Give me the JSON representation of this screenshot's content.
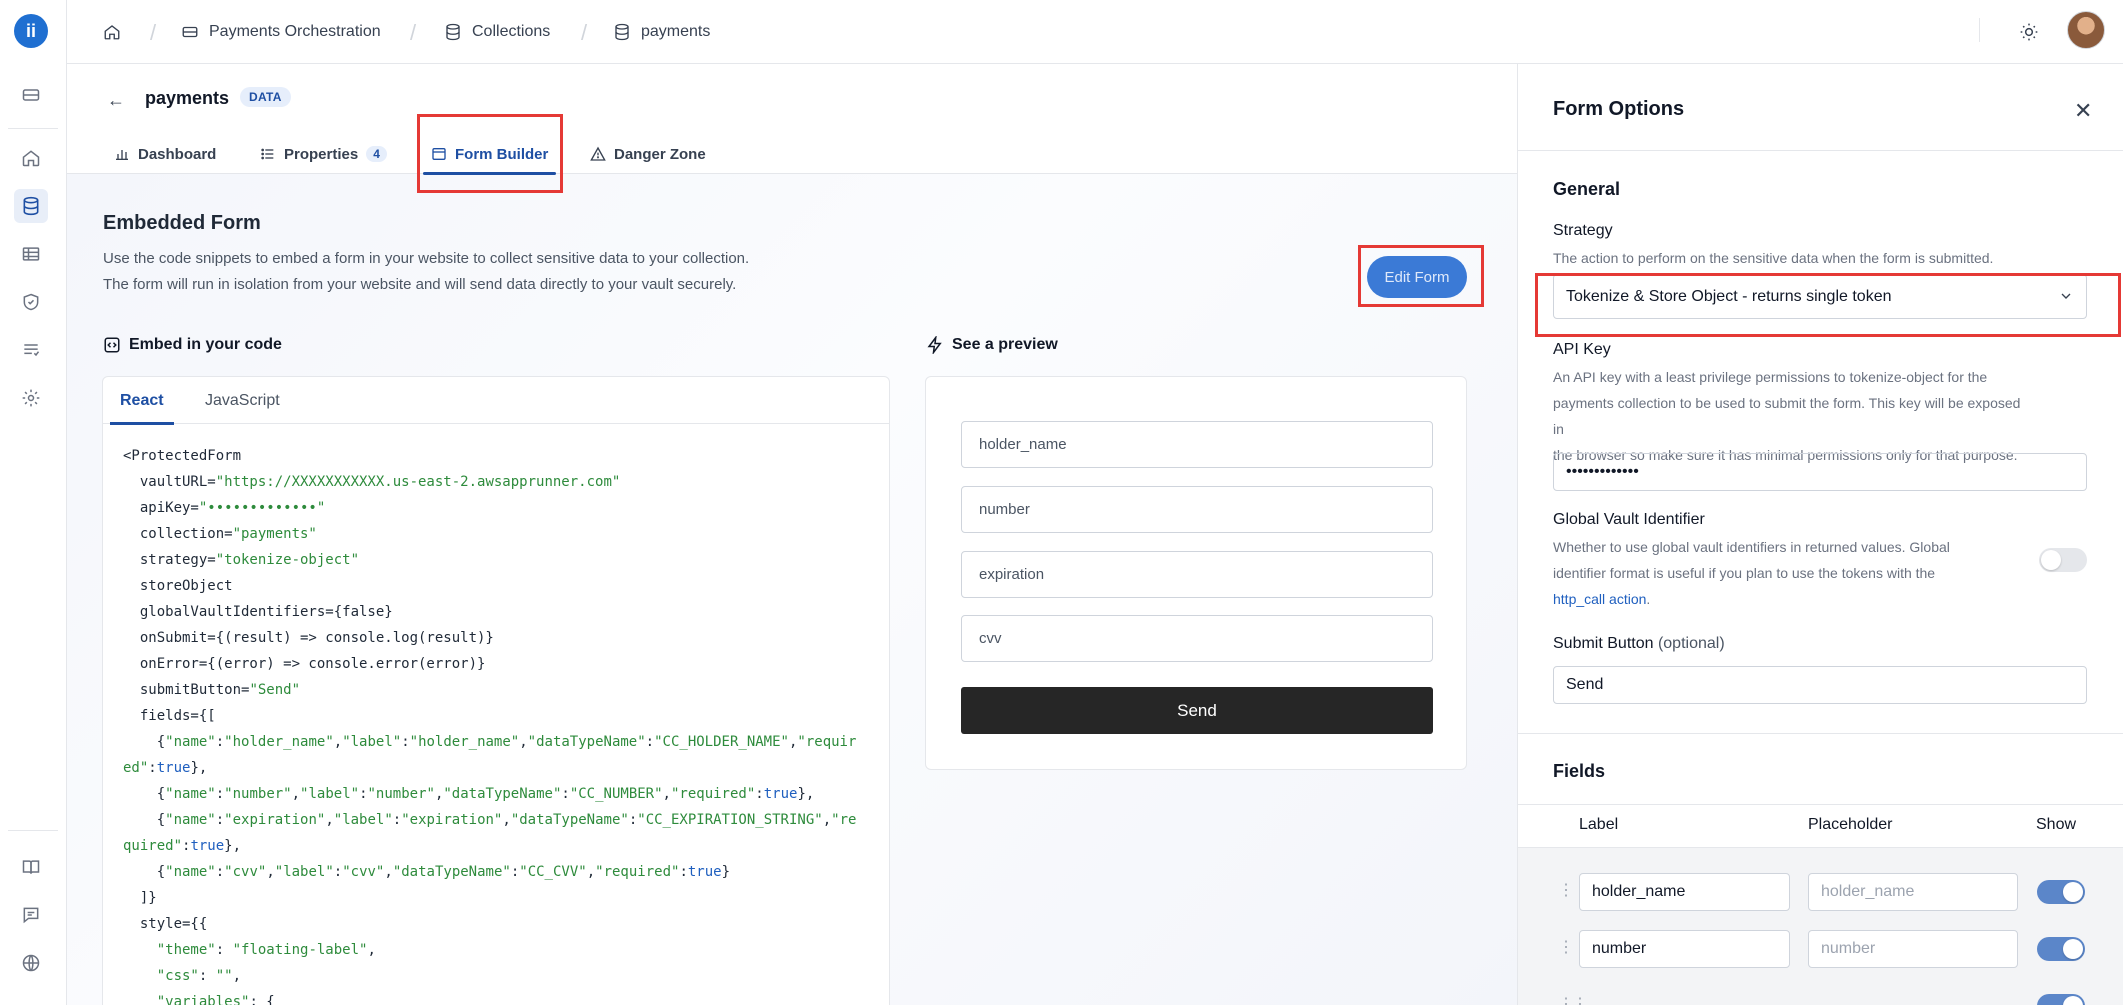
{
  "rail": {
    "logo_text": "ii",
    "icons": [
      "storage-icon",
      "home-icon",
      "database-icon",
      "table-icon",
      "shield-icon",
      "list-icon",
      "settings-icon",
      "book-icon",
      "chat-icon",
      "globe-icon"
    ]
  },
  "breadcrumb": {
    "items": [
      {
        "label": "Payments Orchestration",
        "icon": "storage-icon"
      },
      {
        "label": "Collections",
        "icon": "database-icon"
      },
      {
        "label": "payments",
        "icon": "database-icon"
      }
    ]
  },
  "page": {
    "title": "payments",
    "badge": "DATA"
  },
  "tabs": [
    {
      "label": "Dashboard",
      "icon": "bar-chart-icon"
    },
    {
      "label": "Properties",
      "icon": "list-icon",
      "count": "4"
    },
    {
      "label": "Form Builder",
      "icon": "window-icon",
      "active": true
    },
    {
      "label": "Danger Zone",
      "icon": "warning-icon"
    }
  ],
  "embedded": {
    "heading": "Embedded Form",
    "desc_line1": "Use the code snippets to embed a form in your website to collect sensitive data to your collection.",
    "desc_line2": "The form will run in isolation from your website and will send data directly to your vault securely.",
    "edit_button": "Edit Form",
    "embed_heading": "Embed in your code",
    "preview_heading": "See a preview"
  },
  "code": {
    "tabs": [
      "React",
      "JavaScript"
    ],
    "active_tab": "React",
    "lines": [
      [
        [
          "<ProtectedForm",
          "p"
        ]
      ],
      [
        [
          "  vaultURL=",
          "p"
        ],
        [
          "\"https://XXXXXXXXXXX.us-east-2.awsapprunner.com\"",
          "s"
        ]
      ],
      [
        [
          "  apiKey=",
          "p"
        ],
        [
          "\"•••••••••••••\"",
          "s"
        ]
      ],
      [
        [
          "  collection=",
          "p"
        ],
        [
          "\"payments\"",
          "s"
        ]
      ],
      [
        [
          "  strategy=",
          "p"
        ],
        [
          "\"tokenize-object\"",
          "s"
        ]
      ],
      [
        [
          "  storeObject",
          "p"
        ]
      ],
      [
        [
          "  globalVaultIdentifiers={false}",
          "p"
        ]
      ],
      [
        [
          "  onSubmit={(result) => console.log(result)}",
          "p"
        ]
      ],
      [
        [
          "  onError={(error) => console.error(error)}",
          "p"
        ]
      ],
      [
        [
          "  submitButton=",
          "p"
        ],
        [
          "\"Send\"",
          "s"
        ]
      ],
      [
        [
          "  fields={[",
          "p"
        ]
      ],
      [
        [
          "    {",
          "p"
        ],
        [
          "\"name\"",
          "s"
        ],
        [
          ":",
          "p"
        ],
        [
          "\"holder_name\"",
          "s"
        ],
        [
          ",",
          "p"
        ],
        [
          "\"label\"",
          "s"
        ],
        [
          ":",
          "p"
        ],
        [
          "\"holder_name\"",
          "s"
        ],
        [
          ",",
          "p"
        ],
        [
          "\"dataTypeName\"",
          "s"
        ],
        [
          ":",
          "p"
        ],
        [
          "\"CC_HOLDER_NAME\"",
          "s"
        ],
        [
          ",",
          "p"
        ],
        [
          "\"requir",
          "s"
        ]
      ],
      [
        [
          "ed\"",
          "s"
        ],
        [
          ":",
          "p"
        ],
        [
          "true",
          "b"
        ],
        [
          "},",
          "p"
        ]
      ],
      [
        [
          "    {",
          "p"
        ],
        [
          "\"name\"",
          "s"
        ],
        [
          ":",
          "p"
        ],
        [
          "\"number\"",
          "s"
        ],
        [
          ",",
          "p"
        ],
        [
          "\"label\"",
          "s"
        ],
        [
          ":",
          "p"
        ],
        [
          "\"number\"",
          "s"
        ],
        [
          ",",
          "p"
        ],
        [
          "\"dataTypeName\"",
          "s"
        ],
        [
          ":",
          "p"
        ],
        [
          "\"CC_NUMBER\"",
          "s"
        ],
        [
          ",",
          "p"
        ],
        [
          "\"required\"",
          "s"
        ],
        [
          ":",
          "p"
        ],
        [
          "true",
          "b"
        ],
        [
          "},",
          "p"
        ]
      ],
      [
        [
          "    {",
          "p"
        ],
        [
          "\"name\"",
          "s"
        ],
        [
          ":",
          "p"
        ],
        [
          "\"expiration\"",
          "s"
        ],
        [
          ",",
          "p"
        ],
        [
          "\"label\"",
          "s"
        ],
        [
          ":",
          "p"
        ],
        [
          "\"expiration\"",
          "s"
        ],
        [
          ",",
          "p"
        ],
        [
          "\"dataTypeName\"",
          "s"
        ],
        [
          ":",
          "p"
        ],
        [
          "\"CC_EXPIRATION_STRING\"",
          "s"
        ],
        [
          ",",
          "p"
        ],
        [
          "\"re",
          "s"
        ]
      ],
      [
        [
          "quired\"",
          "s"
        ],
        [
          ":",
          "p"
        ],
        [
          "true",
          "b"
        ],
        [
          "},",
          "p"
        ]
      ],
      [
        [
          "    {",
          "p"
        ],
        [
          "\"name\"",
          "s"
        ],
        [
          ":",
          "p"
        ],
        [
          "\"cvv\"",
          "s"
        ],
        [
          ",",
          "p"
        ],
        [
          "\"label\"",
          "s"
        ],
        [
          ":",
          "p"
        ],
        [
          "\"cvv\"",
          "s"
        ],
        [
          ",",
          "p"
        ],
        [
          "\"dataTypeName\"",
          "s"
        ],
        [
          ":",
          "p"
        ],
        [
          "\"CC_CVV\"",
          "s"
        ],
        [
          ",",
          "p"
        ],
        [
          "\"required\"",
          "s"
        ],
        [
          ":",
          "p"
        ],
        [
          "true",
          "b"
        ],
        [
          "}",
          "p"
        ]
      ],
      [
        [
          "  ]}",
          "p"
        ]
      ],
      [
        [
          "  style={{",
          "p"
        ]
      ],
      [
        [
          "    ",
          "p"
        ],
        [
          "\"theme\"",
          "s"
        ],
        [
          ": ",
          "p"
        ],
        [
          "\"floating-label\"",
          "s"
        ],
        [
          ",",
          "p"
        ]
      ],
      [
        [
          "    ",
          "p"
        ],
        [
          "\"css\"",
          "s"
        ],
        [
          ": ",
          "p"
        ],
        [
          "\"\"",
          "s"
        ],
        [
          ",",
          "p"
        ]
      ],
      [
        [
          "    ",
          "p"
        ],
        [
          "\"variables\"",
          "s"
        ],
        [
          ": {",
          "p"
        ]
      ]
    ]
  },
  "preview": {
    "fields": [
      "holder_name",
      "number",
      "expiration",
      "cvv"
    ],
    "button": "Send"
  },
  "panel": {
    "title": "Form Options",
    "general_heading": "General",
    "strategy_label": "Strategy",
    "strategy_help": "The action to perform on the sensitive data when the form is submitted.",
    "strategy_value": "Tokenize & Store Object - returns single token",
    "apikey_label": "API Key",
    "apikey_help_1": "An API key with a least privilege permissions to tokenize-object for the",
    "apikey_help_2": "payments collection to be used to submit the form. This key will be exposed in",
    "apikey_help_3": "the browser so make sure it has minimal permissions only for that purpose.",
    "apikey_value": "•••••••••••••",
    "gvi_label": "Global Vault Identifier",
    "gvi_help_1": "Whether to use global vault identifiers in returned values. Global",
    "gvi_help_2": "identifier format is useful if you plan to use the tokens with the",
    "gvi_link": "http_call action",
    "gvi_link_tail": ".",
    "gvi_enabled": false,
    "submit_label": "Submit Button",
    "submit_optional": "(optional)",
    "submit_value": "Send",
    "fields_heading": "Fields",
    "columns": [
      "Label",
      "Placeholder",
      "Show"
    ],
    "rows": [
      {
        "label": "holder_name",
        "placeholder": "holder_name",
        "show": true
      },
      {
        "label": "number",
        "placeholder": "number",
        "show": true
      }
    ]
  },
  "colors": {
    "accent": "#1e4fa3",
    "highlight_box": "#e53935",
    "button_blue": "#3b7ad6",
    "send_button": "#262626"
  }
}
